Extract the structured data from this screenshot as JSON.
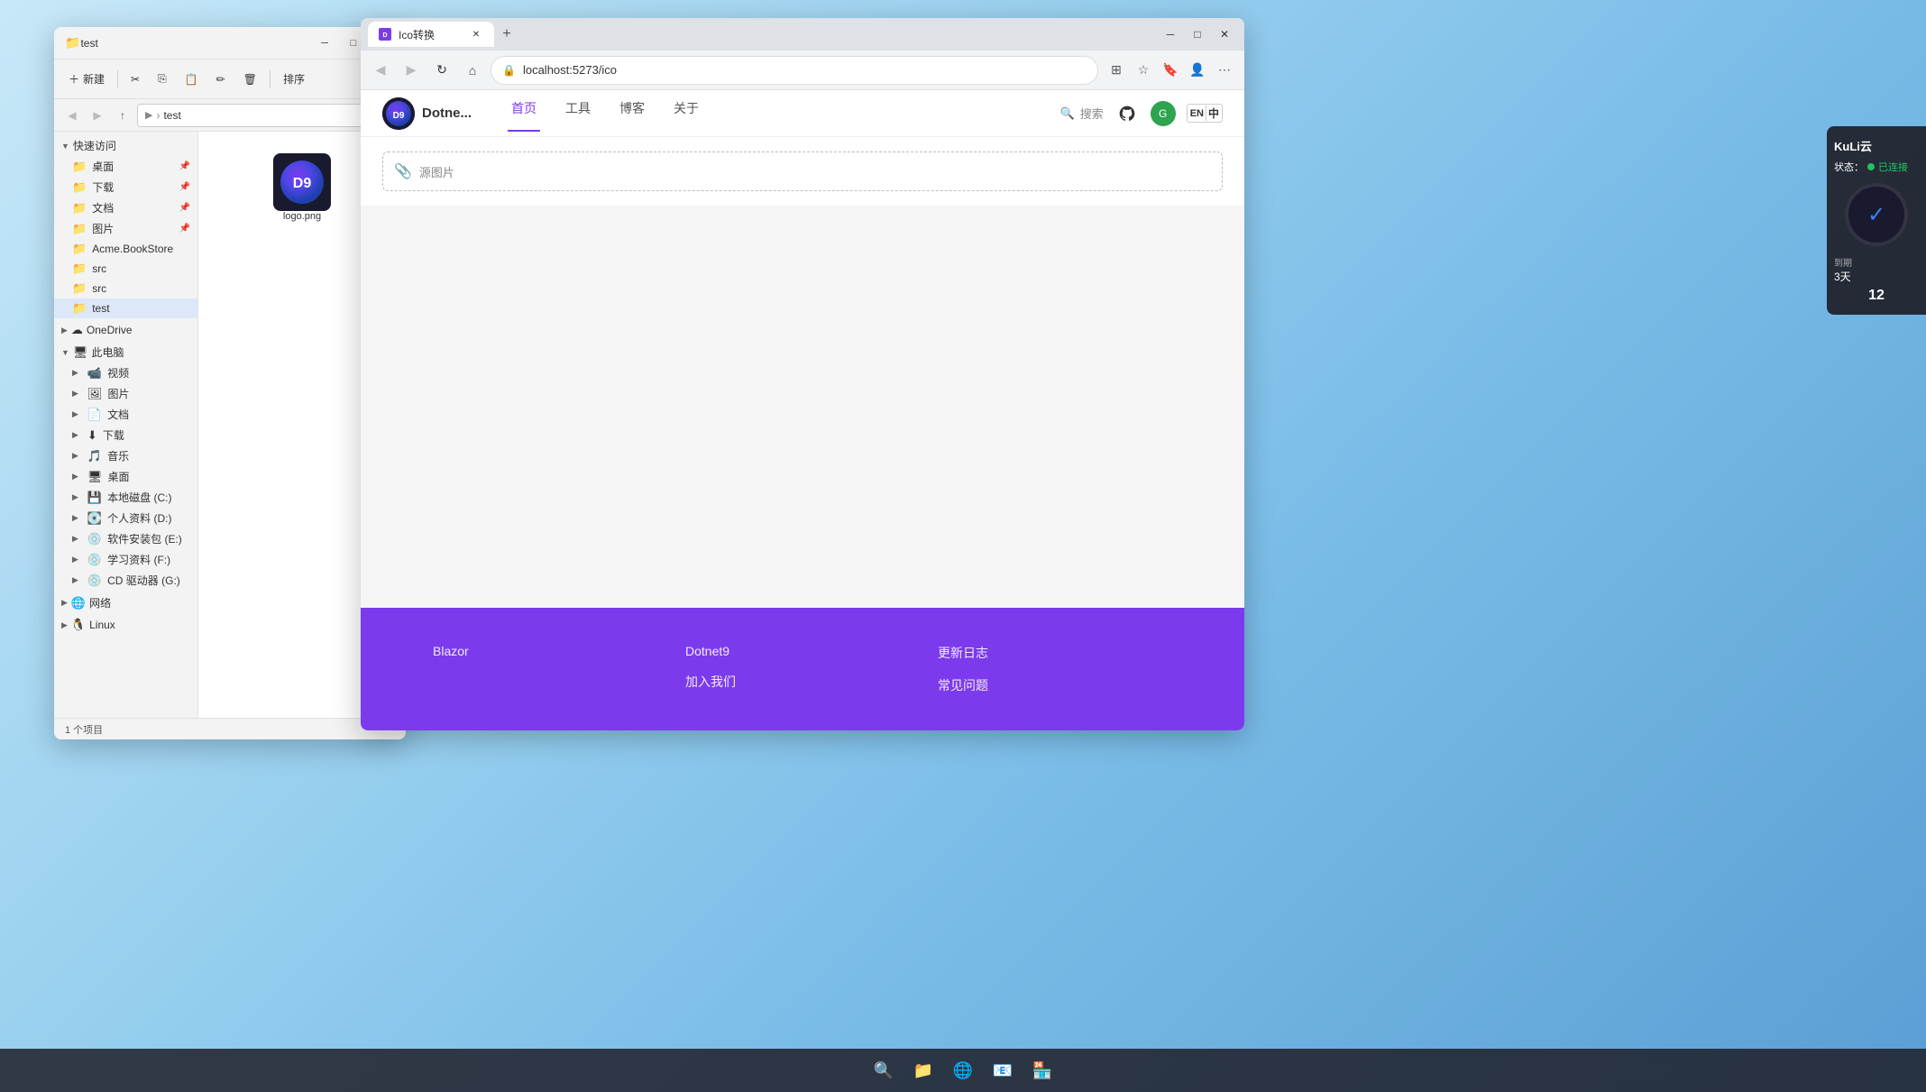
{
  "desktop": {
    "background": "windows11-blue"
  },
  "file_explorer": {
    "title": "test",
    "toolbar": {
      "new_btn": "新建",
      "cut_btn": "✂",
      "copy_btn": "⎘",
      "paste_btn": "📋",
      "rename_btn": "✏",
      "delete_btn": "🗑",
      "sort_btn": "排序"
    },
    "address": {
      "current_path": "test"
    },
    "sidebar": {
      "quick_access_label": "快速访问",
      "items": [
        {
          "label": "桌面",
          "pinned": true
        },
        {
          "label": "下载",
          "pinned": true
        },
        {
          "label": "文档",
          "pinned": true
        },
        {
          "label": "图片",
          "pinned": true
        },
        {
          "label": "Acme.BookStore",
          "pinned": false
        },
        {
          "label": "src",
          "pinned": false
        },
        {
          "label": "src",
          "pinned": false
        },
        {
          "label": "test",
          "pinned": false,
          "active": true
        }
      ],
      "groups": [
        {
          "label": "OneDrive",
          "expanded": false
        },
        {
          "label": "此电脑",
          "expanded": true,
          "children": [
            {
              "label": "视频"
            },
            {
              "label": "图片"
            },
            {
              "label": "文档"
            },
            {
              "label": "下载"
            },
            {
              "label": "音乐"
            },
            {
              "label": "桌面"
            },
            {
              "label": "本地磁盘 (C:)"
            },
            {
              "label": "个人资料 (D:)"
            },
            {
              "label": "软件安装包 (E:)"
            },
            {
              "label": "学习资料 (F:)"
            },
            {
              "label": "CD 驱动器 (G:)"
            }
          ]
        },
        {
          "label": "网络",
          "expanded": false
        },
        {
          "label": "Linux",
          "expanded": false
        }
      ]
    },
    "files": [
      {
        "name": "logo.png",
        "type": "png"
      }
    ],
    "statusbar": {
      "count_label": "1 个项目"
    }
  },
  "browser": {
    "tabs": [
      {
        "label": "Ico转换",
        "active": true,
        "favicon": "🔷"
      }
    ],
    "url": "localhost:5273/ico",
    "website": {
      "logo_text": "Dotne...",
      "logo_initials": "D9",
      "nav_items": [
        {
          "label": "首页",
          "active": true
        },
        {
          "label": "工具",
          "active": false
        },
        {
          "label": "博客",
          "active": false
        },
        {
          "label": "关于",
          "active": false
        }
      ],
      "search_placeholder": "搜索",
      "upload_placeholder": "源图片",
      "footer": {
        "col1": {
          "items": [
            "Blazor"
          ]
        },
        "col2": {
          "items": [
            "Dotnet9",
            "加入我们"
          ]
        },
        "col3": {
          "items": [
            "更新日志",
            "常见问题"
          ]
        }
      }
    }
  },
  "kuli_panel": {
    "title": "KuLi云",
    "status_label": "状态：",
    "status_value": "已连接",
    "expire_label": "到期",
    "days_label": "3天",
    "day_number": "12"
  },
  "taskbar": {
    "items": [
      "🔍",
      "📁",
      "🌐",
      "📧",
      "🏪"
    ]
  }
}
